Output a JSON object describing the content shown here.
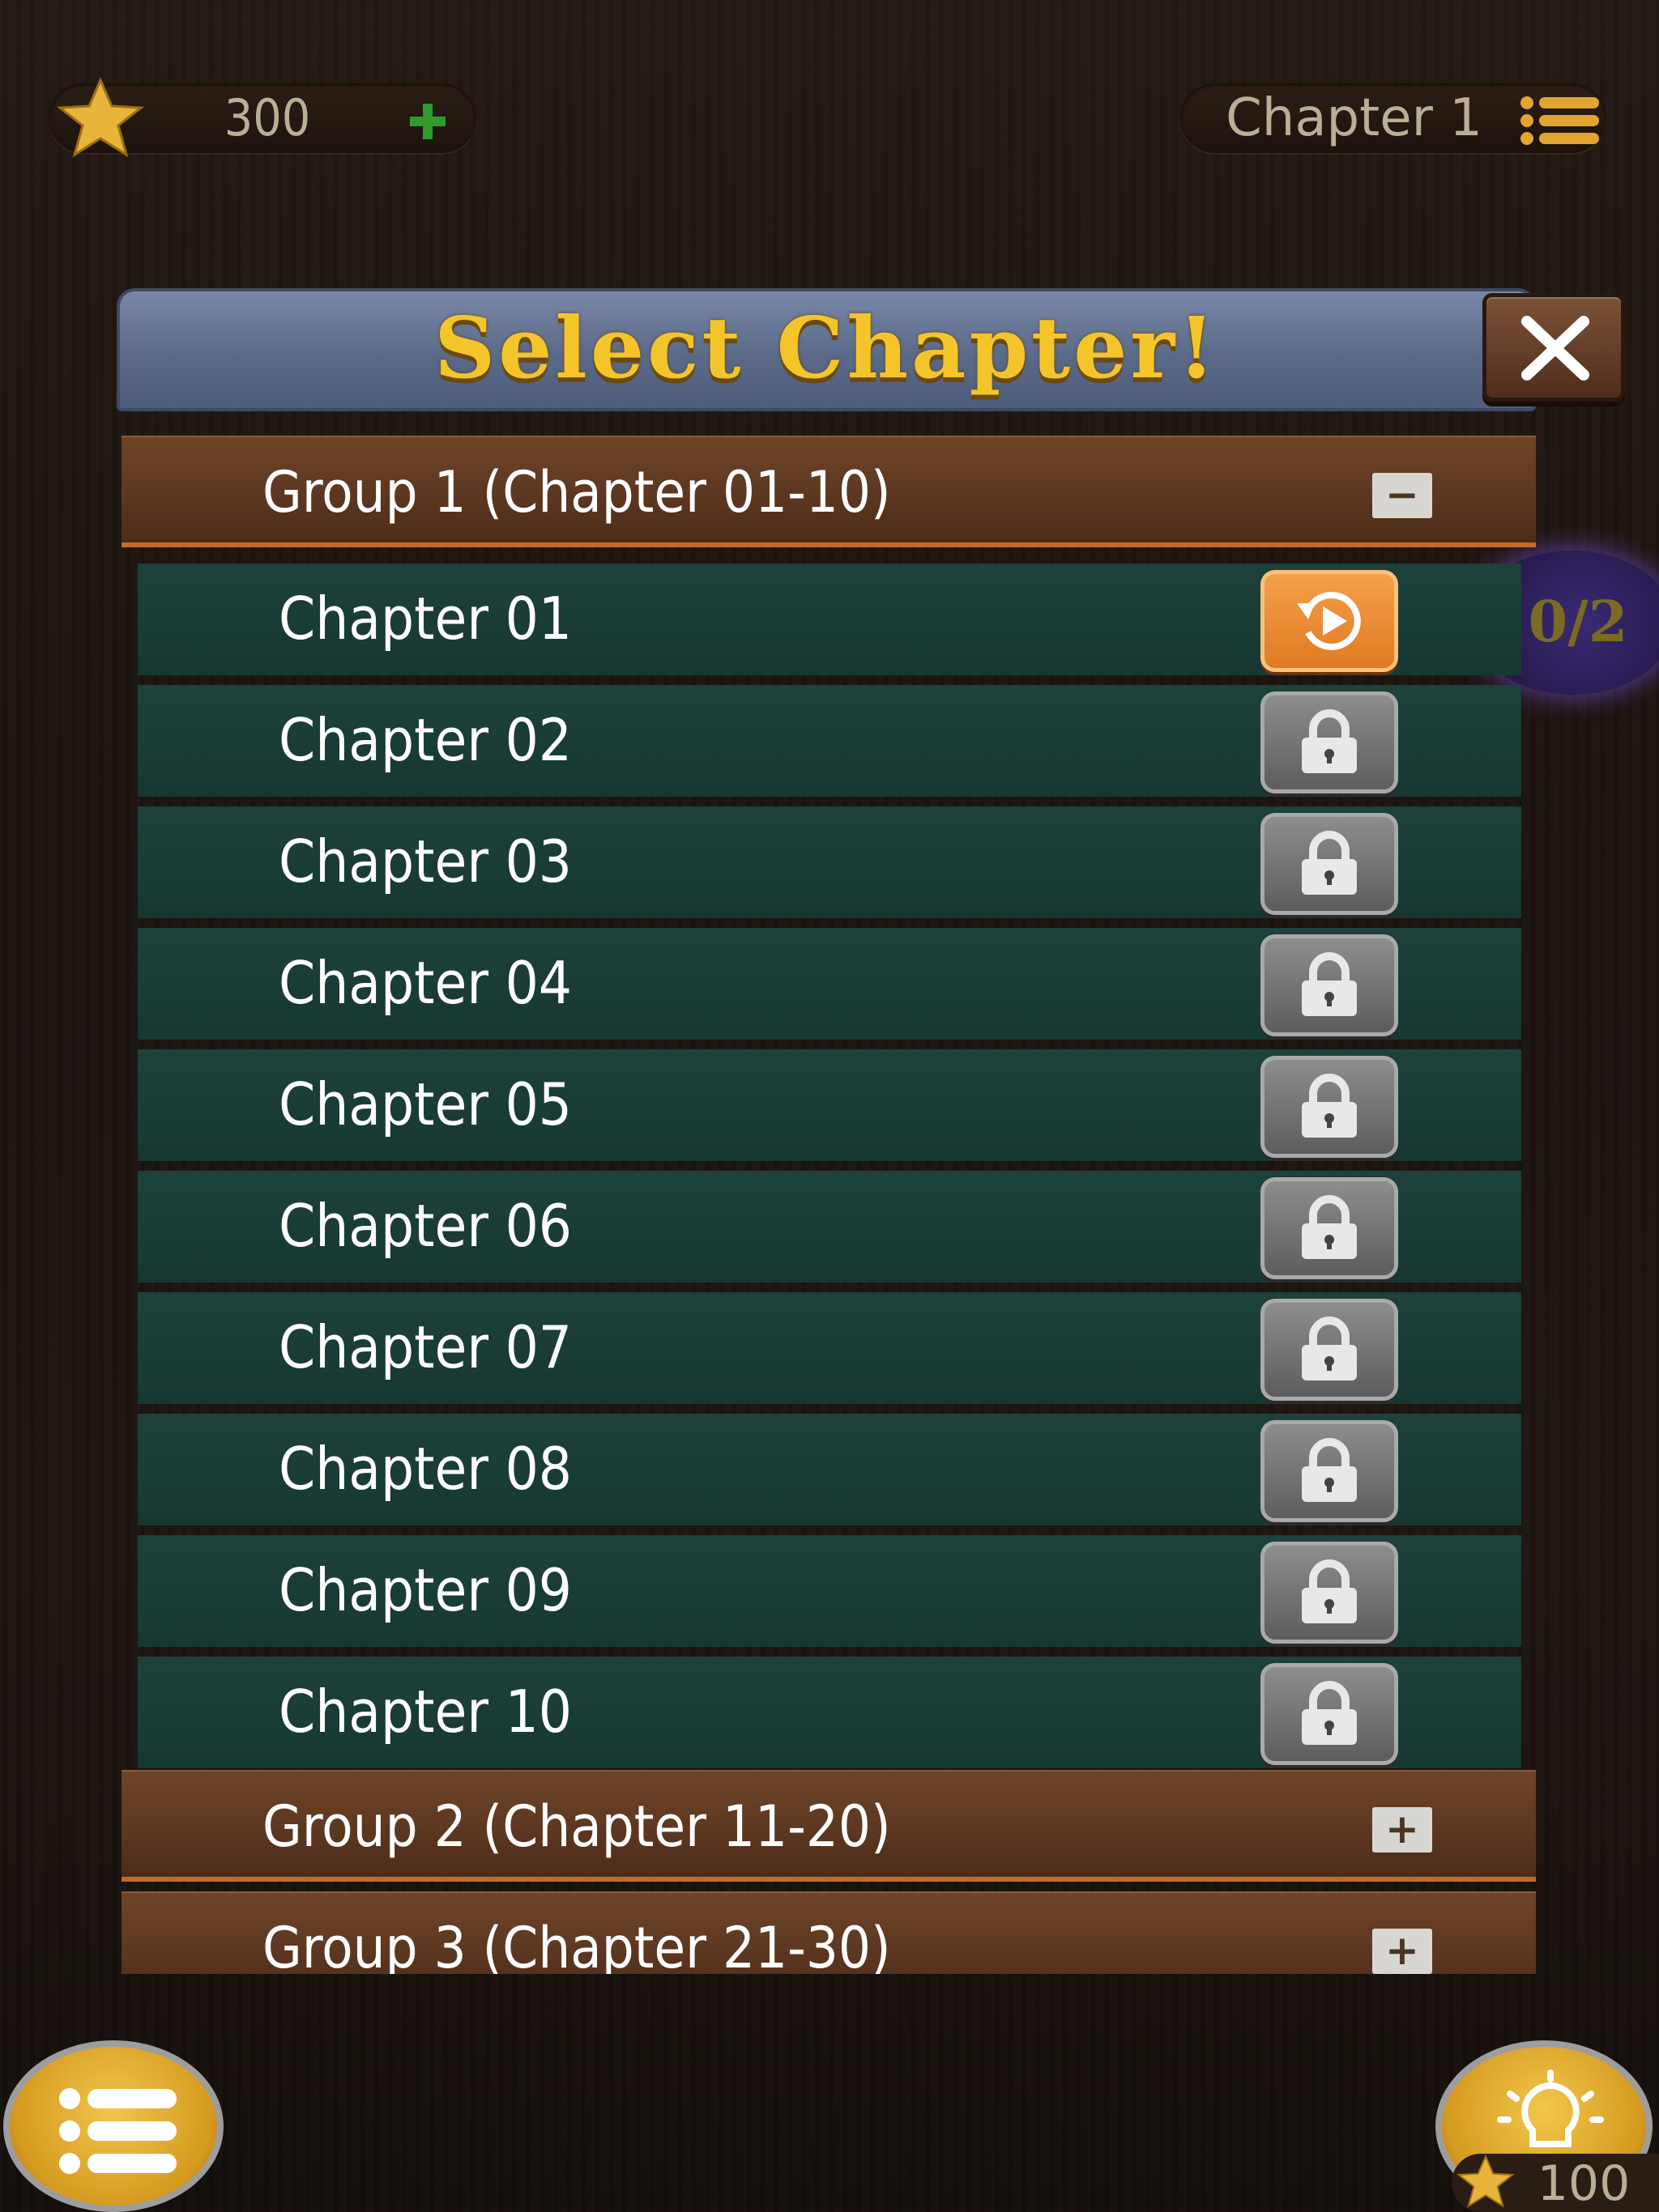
{
  "hud": {
    "score": "300",
    "current_chapter": "Chapter 1"
  },
  "dialog": {
    "title": "Select Chapter!",
    "groups": [
      {
        "label": "Group 1 (Chapter 01-10)",
        "toggle": "−",
        "expanded": true,
        "chapters": [
          {
            "label": "Chapter 01",
            "state": "play"
          },
          {
            "label": "Chapter 02",
            "state": "locked"
          },
          {
            "label": "Chapter 03",
            "state": "locked"
          },
          {
            "label": "Chapter 04",
            "state": "locked"
          },
          {
            "label": "Chapter 05",
            "state": "locked"
          },
          {
            "label": "Chapter 06",
            "state": "locked"
          },
          {
            "label": "Chapter 07",
            "state": "locked"
          },
          {
            "label": "Chapter 08",
            "state": "locked"
          },
          {
            "label": "Chapter 09",
            "state": "locked"
          },
          {
            "label": "Chapter 10",
            "state": "locked"
          }
        ]
      },
      {
        "label": "Group 2 (Chapter 11-20)",
        "toggle": "+",
        "expanded": false
      },
      {
        "label": "Group 3 (Chapter 21-30)",
        "toggle": "+",
        "expanded": false
      }
    ]
  },
  "progress_badge": "0/2",
  "hint": {
    "cost": "100"
  },
  "colors": {
    "title_gold": "#f4c52b",
    "title_bar": "#5a6a88",
    "group_row": "#5b3620",
    "chapter_row": "#1d413b",
    "play_orange": "#e07a22",
    "lock_gray": "#6d6d6d"
  },
  "icons": {
    "score": "star-icon",
    "add": "plus-icon",
    "menu": "hamburger-icon",
    "close": "close-icon",
    "play": "replay-play-icon",
    "locked": "padlock-icon",
    "hint": "lightbulb-icon"
  }
}
